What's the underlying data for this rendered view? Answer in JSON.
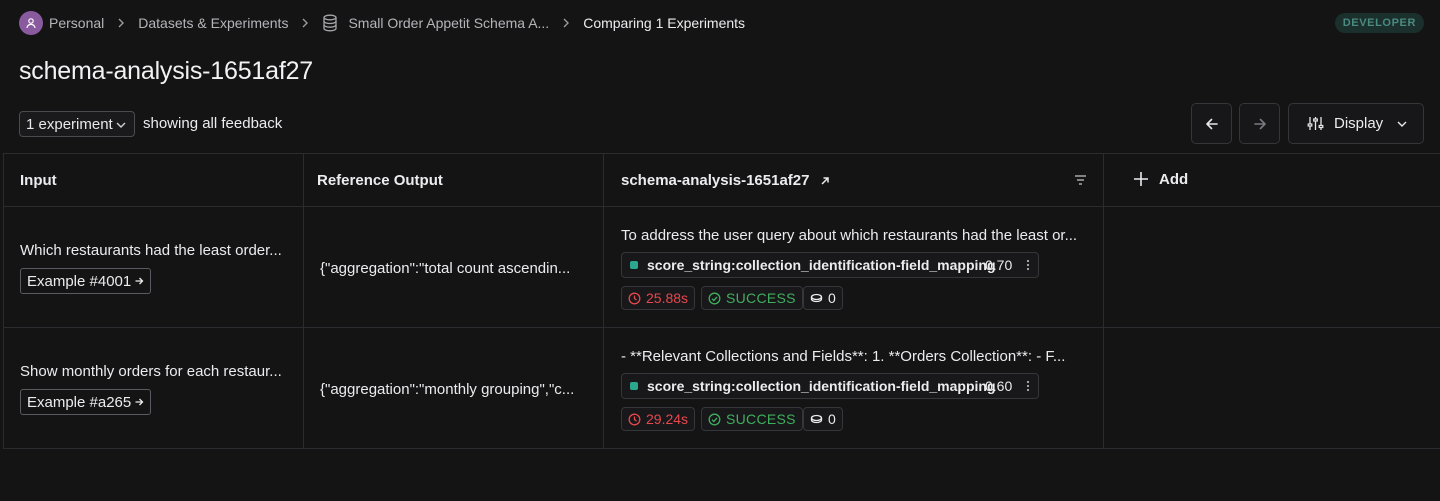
{
  "breadcrumb": {
    "workspace": "Personal",
    "section": "Datasets & Experiments",
    "dataset": "Small Order Appetit Schema A...",
    "current": "Comparing 1 Experiments"
  },
  "badge": "DEVELOPER",
  "page_title": "schema-analysis-1651af27",
  "toolbar": {
    "experiment_select": "1 experiment",
    "feedback_text": "showing all feedback",
    "display_label": "Display"
  },
  "table": {
    "headers": {
      "input": "Input",
      "reference": "Reference Output",
      "experiment": "schema-analysis-1651af27",
      "add": "Add"
    },
    "rows": [
      {
        "input": "Which restaurants had the least order...",
        "example": "Example #4001",
        "reference": "{\"aggregation\":\"total count ascendin...",
        "output": "To address the user query about which restaurants had the least or...",
        "score_name": "score_string:collection_identification-field_mapping",
        "score_value": "0.70",
        "latency": "25.88s",
        "status": "SUCCESS",
        "tokens": "0"
      },
      {
        "input": "Show monthly orders for each restaur...",
        "example": "Example #a265",
        "reference": "{\"aggregation\":\"monthly grouping\",\"c...",
        "output": "- **Relevant Collections and Fields**: 1. **Orders Collection**: - F...",
        "score_name": "score_string:collection_identification-field_mapping",
        "score_value": "0.60",
        "latency": "29.24s",
        "status": "SUCCESS",
        "tokens": "0"
      }
    ]
  },
  "colors": {
    "background": "#141415",
    "score_dot": "#2ba68f",
    "latency": "#e5484d",
    "success": "#3fae5d",
    "badge_text": "#4a8a80"
  },
  "icons": [
    "user-icon",
    "chevron-right-icon",
    "database-icon",
    "chevron-down-icon",
    "arrow-left-icon",
    "arrow-right-icon",
    "sliders-icon",
    "external-link-icon",
    "filter-icon",
    "plus-icon",
    "clock-icon",
    "check-circle-icon",
    "coins-icon",
    "more-vertical-icon"
  ]
}
